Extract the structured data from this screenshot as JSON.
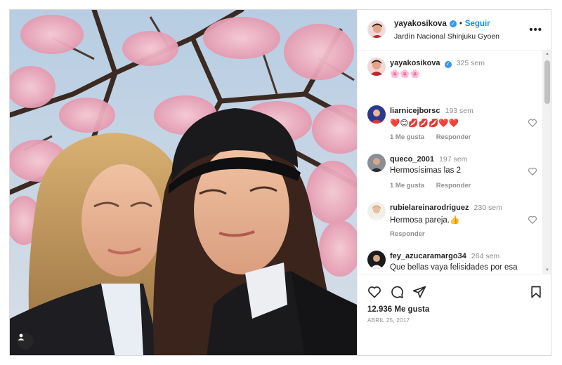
{
  "post": {
    "username": "yayakosikova",
    "follow_label": "Seguir",
    "separator": "•",
    "location": "Jardín Nacional Shinjuku Gyoen",
    "more_label": "•••",
    "caption_ago": "325 sem",
    "caption_text": "🌸🌸🌸"
  },
  "comments": [
    {
      "username": "liarnicejborsc",
      "ago": "193 sem",
      "text": "❤️😊💋💋💋❤️❤️",
      "likes_label": "1 Me gusta",
      "reply_label": "Responder"
    },
    {
      "username": "queco_2001",
      "ago": "197 sem",
      "text": "Hermosísimas las 2",
      "likes_label": "1 Me gusta",
      "reply_label": "Responder"
    },
    {
      "username": "rubielareinarodriguez",
      "ago": "230 sem",
      "text": "Hermosa pareja.👍",
      "reply_label": "Responder"
    },
    {
      "username": "fey_azucaramargo34",
      "ago": "264 sem",
      "text": "Que bellas vaya felisidades por esa"
    }
  ],
  "footer": {
    "likes": "12.936 Me gusta",
    "date": "ABRIL 25, 2017"
  },
  "colors": {
    "accent": "#0095f6",
    "verified": "#3897f0",
    "border": "#dbdbdb"
  },
  "icons": [
    "verified-icon",
    "more-icon",
    "heart-icon",
    "comment-icon",
    "share-icon",
    "save-icon",
    "user-tag-icon"
  ]
}
